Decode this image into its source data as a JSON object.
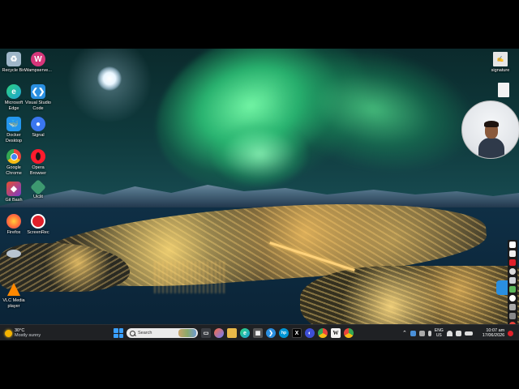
{
  "desktop_icons": [
    {
      "label": "Recycle Bin",
      "icon": "recycle-bin-icon",
      "color": "#9fb7c9"
    },
    {
      "label": "Wampserve...",
      "icon": "wampserver-icon",
      "color": "#d6367a"
    },
    {
      "label": "Microsoft Edge",
      "icon": "edge-icon",
      "color": "#1fa3d6"
    },
    {
      "label": "Visual Studio Code",
      "icon": "vscode-icon",
      "color": "#2a8fe0"
    },
    {
      "label": "Docker Desktop",
      "icon": "docker-icon",
      "color": "#2496ed"
    },
    {
      "label": "Signal",
      "icon": "signal-icon",
      "color": "#3a76f0"
    },
    {
      "label": "Google Chrome",
      "icon": "chrome-icon",
      "color": "#e8453c"
    },
    {
      "label": "Opera Browser",
      "icon": "opera-icon",
      "color": "#ff1b2d"
    },
    {
      "label": "Git Bash",
      "icon": "git-bash-icon",
      "color": "#e84e31"
    },
    {
      "label": "Uiclit",
      "icon": "uiclit-icon",
      "color": "#3d9970"
    },
    {
      "label": "Firefox",
      "icon": "firefox-icon",
      "color": "#ff7139"
    },
    {
      "label": "ScreenRec",
      "icon": "screenrec-icon",
      "color": "#e0202a"
    },
    {
      "label": "",
      "icon": "network-drive-icon",
      "color": "#b8c4d0"
    },
    {
      "label": "VLC Media player",
      "icon": "vlc-icon",
      "color": "#ff8800"
    },
    {
      "label": "signature",
      "icon": "signature-file-icon",
      "color": "#e6e6e6"
    }
  ],
  "weather": {
    "temp": "30°C",
    "condition": "Mostly sunny"
  },
  "search": {
    "placeholder": "Search"
  },
  "taskbar_apps": [
    {
      "name": "file-explorer",
      "glyph": "▤",
      "color": "#e9b949"
    },
    {
      "name": "copilot",
      "glyph": "◆",
      "color": "#6a7dff"
    },
    {
      "name": "edge",
      "glyph": "e",
      "color": "#1fa3d6"
    },
    {
      "name": "calculator",
      "glyph": "▦",
      "color": "#555"
    },
    {
      "name": "gemini",
      "glyph": "✦",
      "color": "#4a8df6"
    },
    {
      "name": "hp",
      "glyph": "hp",
      "color": "#0096d6"
    },
    {
      "name": "x",
      "glyph": "X",
      "color": "#000"
    },
    {
      "name": "edge-app",
      "glyph": "◐",
      "color": "#2e7bd6"
    },
    {
      "name": "chrome",
      "glyph": "●",
      "color": "#e8453c"
    },
    {
      "name": "wikipedia",
      "glyph": "W",
      "color": "#f2f2f2"
    },
    {
      "name": "chrome-2",
      "glyph": "●",
      "color": "#34a853"
    }
  ],
  "tray": {
    "lang_top": "ENG",
    "lang_bottom": "US",
    "time": "10:07 am",
    "date": "17/06/2026"
  }
}
